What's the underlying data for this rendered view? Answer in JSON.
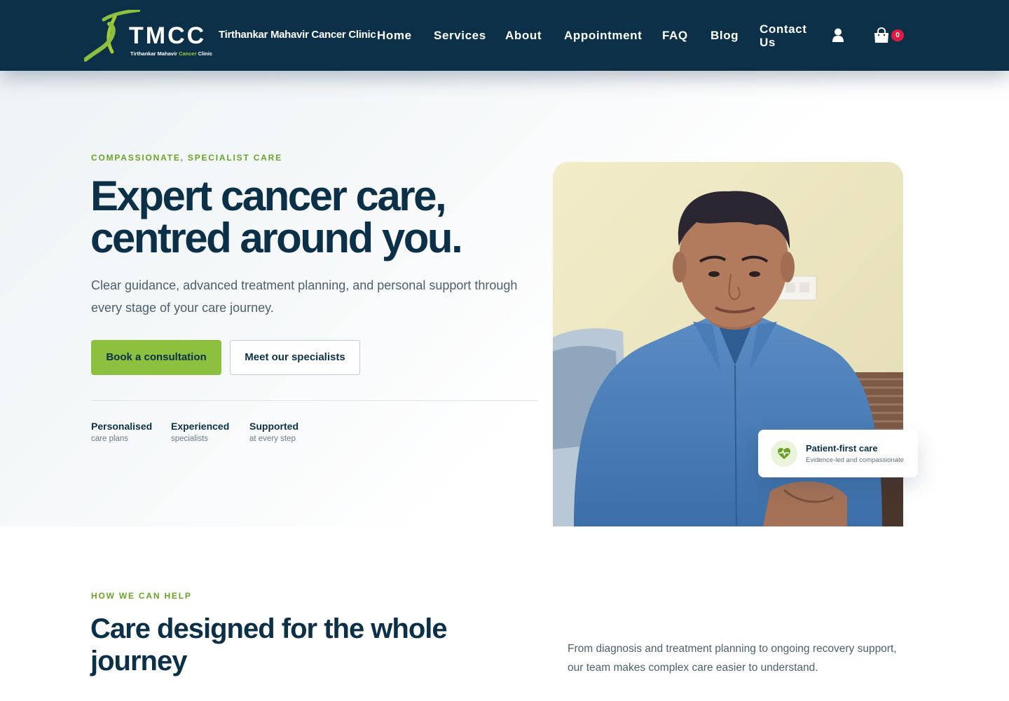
{
  "header": {
    "logo_text": "TMCC",
    "logo_sub_before": "Tirthankar Mahavir ",
    "logo_sub_accent": "Cancer",
    "logo_sub_after": " Clinic",
    "brand_name": "Tirthankar Mahavir Cancer Clinic",
    "nav": [
      "Home",
      "Services",
      "About",
      "Appointment",
      "FAQ",
      "Blog"
    ],
    "contact_line1": "Contact",
    "contact_line2": "Us",
    "cart_count": "0",
    "icons": [
      "ribbon-logo-icon",
      "user-icon",
      "shopping-bag-icon"
    ],
    "colors": {
      "navy": "#0b3048",
      "green": "#8dc03e",
      "badge_red": "#e0193f"
    }
  },
  "hero": {
    "eyebrow": "COMPASSIONATE, SPECIALIST CARE",
    "title_line1": "Expert cancer care,",
    "title_line2": "centred around you.",
    "description": "Clear guidance, advanced treatment planning, and personal support through every stage of your care journey.",
    "primary_cta": "Book a consultation",
    "secondary_cta": "Meet our specialists",
    "features": [
      {
        "title": "Personalised",
        "subtitle": "care plans"
      },
      {
        "title": "Experienced",
        "subtitle": "specialists"
      },
      {
        "title": "Supported",
        "subtitle": "at every step"
      }
    ],
    "card": {
      "icon": "heartbeat-icon",
      "title": "Patient-first care",
      "subtitle": "Evidence-led and compassionate"
    }
  },
  "help": {
    "eyebrow": "HOW WE CAN HELP",
    "title": "Care designed for the whole journey",
    "description": "From diagnosis and treatment planning to ongoing recovery support, our team makes complex care easier to understand."
  }
}
